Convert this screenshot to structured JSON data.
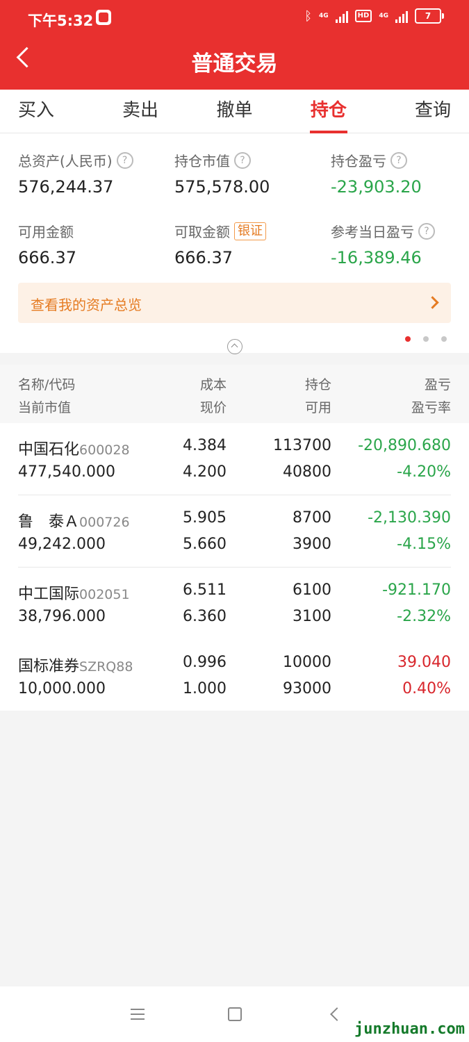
{
  "status_bar": {
    "time": "下午5:32",
    "net1": "4G",
    "net2": "4G",
    "hd": "HD",
    "battery": "7"
  },
  "header": {
    "title": "普通交易"
  },
  "tabs": [
    {
      "label": "买入",
      "active": false
    },
    {
      "label": "卖出",
      "active": false
    },
    {
      "label": "撤单",
      "active": false
    },
    {
      "label": "持仓",
      "active": true
    },
    {
      "label": "查询",
      "active": false
    }
  ],
  "summary": {
    "total_assets_label": "总资产(人民币)",
    "total_assets": "576,244.37",
    "market_value_label": "持仓市值",
    "market_value": "575,578.00",
    "position_pnl_label": "持仓盈亏",
    "position_pnl": "-23,903.20",
    "available_label": "可用金额",
    "available": "666.37",
    "withdrawable_label": "可取金额",
    "withdrawable_badge": "银证",
    "withdrawable": "666.37",
    "daily_pnl_label": "参考当日盈亏",
    "daily_pnl": "-16,389.46",
    "help_glyph": "?"
  },
  "banner": {
    "label": "查看我的资产总览"
  },
  "table": {
    "headers": {
      "name_code": "名称/代码",
      "cost": "成本",
      "holding": "持仓",
      "pnl": "盈亏",
      "market_value": "当前市值",
      "price": "现价",
      "available": "可用",
      "pnl_rate": "盈亏率"
    },
    "rows": [
      {
        "name": "中国石化",
        "code": "600028",
        "cost": "4.384",
        "holding": "113700",
        "pnl": "-20,890.680",
        "market_value": "477,540.000",
        "price": "4.200",
        "available": "40800",
        "pnl_rate": "-4.20%"
      },
      {
        "name": "鲁　泰Ａ",
        "code": "000726",
        "cost": "5.905",
        "holding": "8700",
        "pnl": "-2,130.390",
        "market_value": "49,242.000",
        "price": "5.660",
        "available": "3900",
        "pnl_rate": "-4.15%"
      },
      {
        "name": "中工国际",
        "code": "002051",
        "cost": "6.511",
        "holding": "6100",
        "pnl": "-921.170",
        "market_value": "38,796.000",
        "price": "6.360",
        "available": "3100",
        "pnl_rate": "-2.32%"
      },
      {
        "name": "国标准券",
        "code": "SZRQ88",
        "cost": "0.996",
        "holding": "10000",
        "pnl": "39.040",
        "market_value": "10,000.000",
        "price": "1.000",
        "available": "93000",
        "pnl_rate": "0.40%"
      }
    ]
  },
  "watermark": "junzhuan.com",
  "colors": {
    "brand_red": "#e8302f",
    "loss_green": "#2aa54a",
    "gain_red": "#d8262c",
    "accent_orange": "#e57b22"
  }
}
